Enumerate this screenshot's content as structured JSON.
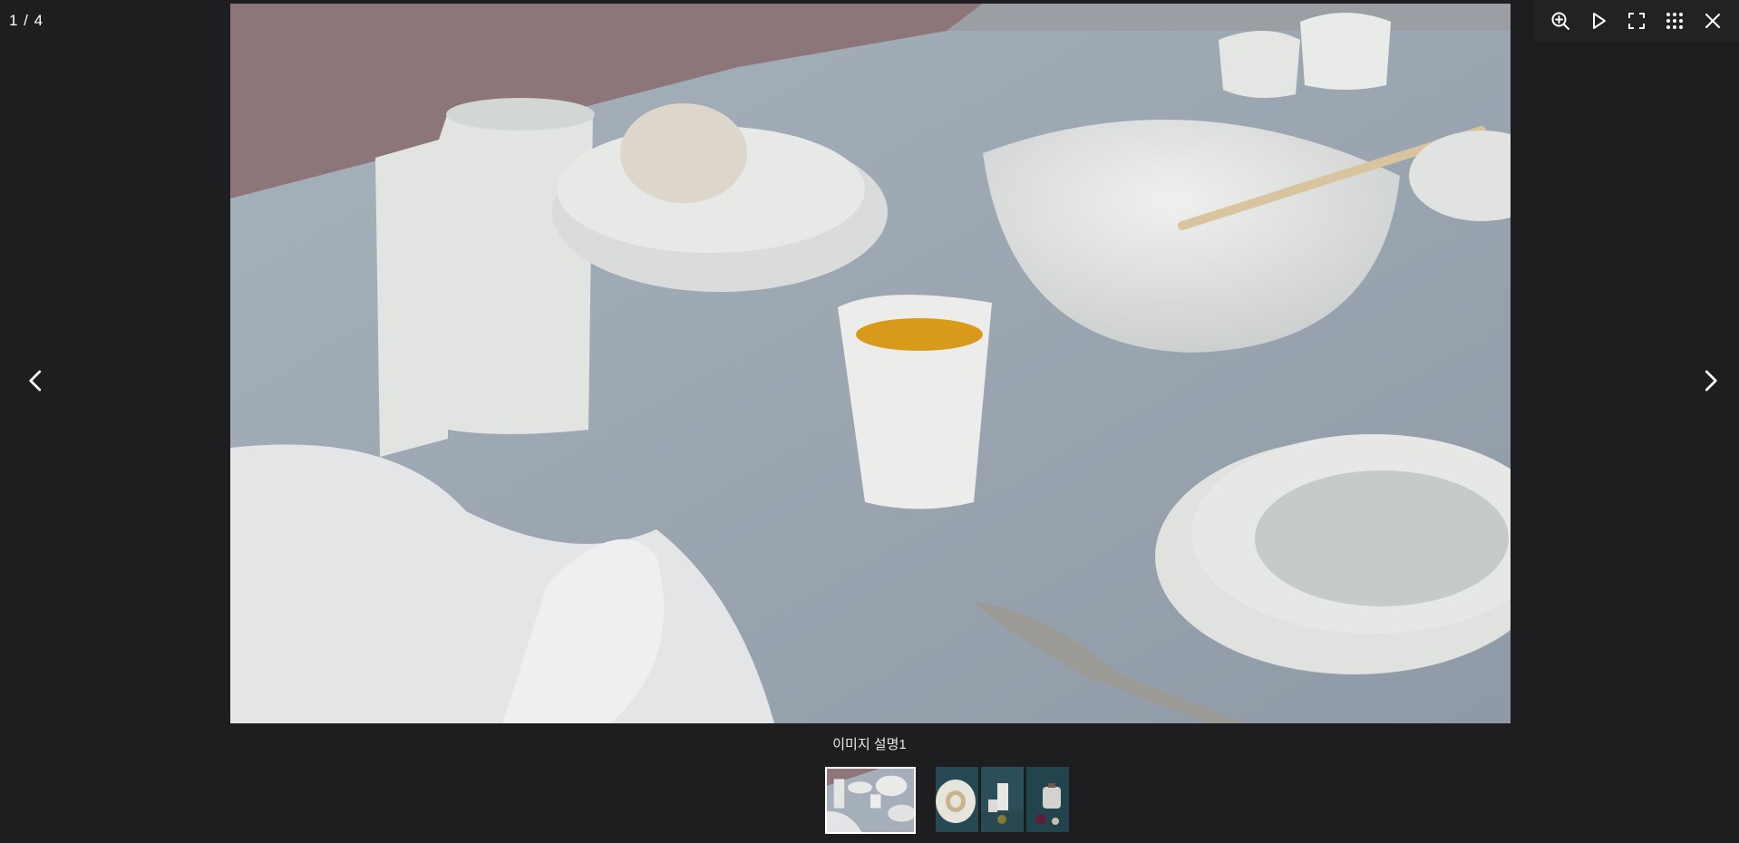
{
  "viewer": {
    "counter": "1 / 4",
    "caption": "이미지 설명1"
  },
  "toolbar": {
    "items": [
      {
        "icon": "zoom-in-icon"
      },
      {
        "icon": "play-icon"
      },
      {
        "icon": "fullscreen-icon"
      },
      {
        "icon": "grid-icon"
      },
      {
        "icon": "close-icon"
      }
    ]
  },
  "navigation": {
    "prev_icon": "chevron-left-icon",
    "next_icon": "chevron-right-icon"
  },
  "thumbnails": [
    {
      "active": true
    },
    {
      "active": false
    },
    {
      "active": false
    },
    {
      "active": false
    }
  ],
  "colors": {
    "background": "#1e1e20",
    "toolbar": "#222225",
    "table_cloth": "#9aa6b1",
    "wall": "#8d7679",
    "thumb_bg": "#264953",
    "ceramic": "#e4e6e3"
  }
}
